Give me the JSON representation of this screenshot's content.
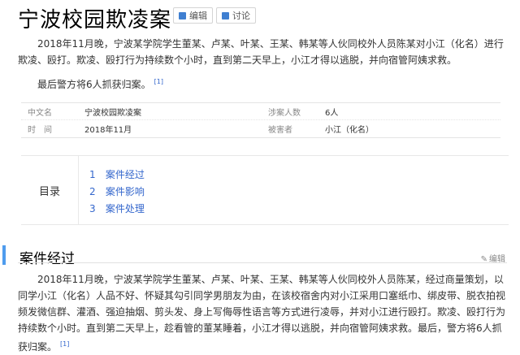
{
  "page": {
    "title": "宁波校园欺凌案",
    "edit_label": "编辑",
    "discuss_label": "讨论"
  },
  "summary": {
    "p1": "2018年11月晚，宁波某学院学生董某、卢某、叶某、王某、韩某等人伙同校外人员陈某对小江（化名）进行欺凌、殴打。欺凌、殴打行为持续数个小时，直到第二天早上，小江才得以逃脱，并向宿管阿姨求救。",
    "p2": "最后警方将6人抓获归案。",
    "cite": "[1]"
  },
  "infobox": {
    "rows": [
      {
        "label": "中文名",
        "value": "宁波校园欺凌案",
        "label2": "涉案人数",
        "value2": "6人"
      },
      {
        "label": "时　间",
        "value": "2018年11月",
        "label2": "被害者",
        "value2": "小江（化名）"
      }
    ]
  },
  "toc": {
    "heading": "目录",
    "items": [
      {
        "num": "1",
        "label": "案件经过"
      },
      {
        "num": "2",
        "label": "案件影响"
      },
      {
        "num": "3",
        "label": "案件处理"
      }
    ]
  },
  "section": {
    "title": "案件经过",
    "edit_label": "编辑",
    "body": "2018年11月晚，宁波某学院学生董某、卢某、叶某、王某、韩某等人伙同校外人员陈某，经过商量策划，以同学小江（化名）人品不好、怀疑其勾引同学男朋友为由，在该校宿舍内对小江采用口塞纸巾、绑皮带、脱衣拍视频发微信群、灌酒、强迫抽烟、剪头发、身上写侮辱性语言等方式进行凌辱，并对小江进行殴打。欺凌、殴打行为持续数个小时。直到第二天早上，趁看管的董某睡着，小江才得以逃脱，并向宿管阿姨求救。最后，警方将6人抓获归案。",
    "cite": "[1]"
  },
  "colors": {
    "accent": "#4f9cee",
    "link": "#3366cc"
  }
}
